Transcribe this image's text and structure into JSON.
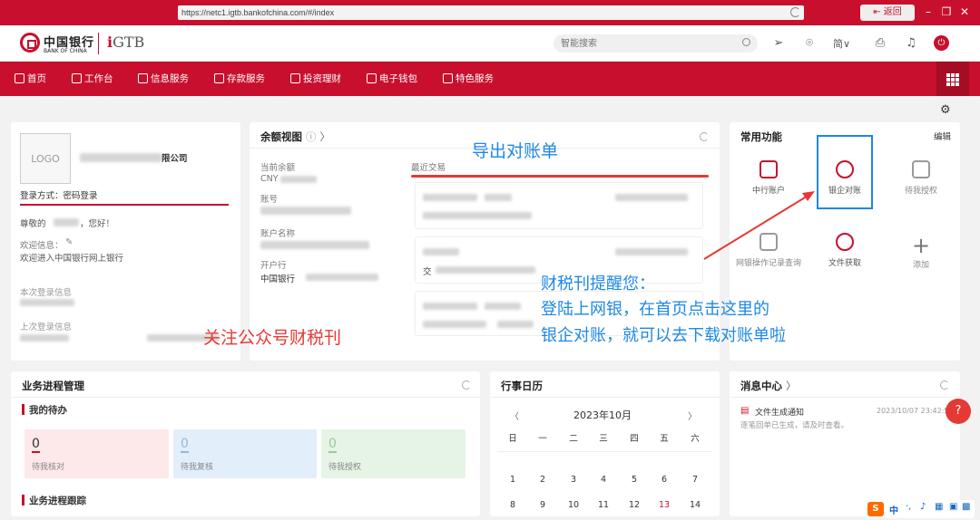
{
  "browser": {
    "url": "https://netc1.igtb.bankofchina.com/#/index",
    "back_label": "返回",
    "minimize": "–",
    "restore": "❐",
    "close": "✕"
  },
  "header": {
    "bank_name": "中国银行",
    "bank_en": "BANK OF CHINA",
    "gtb": "GTB",
    "gtb_prefix": "i",
    "search_placeholder": "智能搜索",
    "lang": "简∨"
  },
  "nav": {
    "items": [
      {
        "label": "首页"
      },
      {
        "label": "工作台"
      },
      {
        "label": "信息服务"
      },
      {
        "label": "存款服务"
      },
      {
        "label": "投资理财"
      },
      {
        "label": "电子钱包"
      },
      {
        "label": "特色服务"
      }
    ]
  },
  "profile": {
    "logo": "LOGO",
    "company_suffix": "限公司",
    "login_method": "登录方式：密码登录",
    "greeting_prefix": "尊敬的",
    "greeting_suffix": "，您好！",
    "welcome_label": "欢迎信息：",
    "welcome_text": "欢迎进入中国银行网上银行",
    "this_login": "本次登录信息",
    "last_login": "上次登录信息"
  },
  "balance": {
    "title": "余额视图",
    "current_balance": "当前余额",
    "currency": "CNY",
    "account_no": "账号",
    "account_name": "账户名称",
    "bank_branch": "开户行",
    "branch_value": "中国银行",
    "recent": "最近交易",
    "tx_prefix_1": "交",
    "tx_prefix_2": "交"
  },
  "quick": {
    "title": "常用功能",
    "edit": "编辑",
    "items": [
      {
        "label": "中行账户",
        "icon": "card-icon"
      },
      {
        "label": "银企对账",
        "icon": "yuan-icon"
      },
      {
        "label": "待我授权",
        "icon": "list-icon"
      },
      {
        "label": "网银操作记录查询",
        "icon": "monitor-icon"
      },
      {
        "label": "文件获取",
        "icon": "download-icon"
      },
      {
        "label": "添加",
        "icon": "plus-icon"
      }
    ]
  },
  "process": {
    "title": "业务进程管理",
    "my_todo": "我的待办",
    "todos": [
      {
        "count": "0",
        "label": "待我核对"
      },
      {
        "count": "0",
        "label": "待我复核"
      },
      {
        "count": "0",
        "label": "待我授权"
      }
    ],
    "tracking": "业务进程跟踪"
  },
  "calendar": {
    "title": "行事日历",
    "month": "2023年10月",
    "prev": "〈",
    "next": "〉",
    "weekdays": [
      "日",
      "一",
      "二",
      "三",
      "四",
      "五",
      "六"
    ],
    "row1": [
      "1",
      "2",
      "3",
      "4",
      "5",
      "6",
      "7"
    ],
    "row2": [
      "8",
      "9",
      "10",
      "11",
      "12",
      "13",
      "14"
    ]
  },
  "messages": {
    "title": "消息中心",
    "item_title": "文件生成通知",
    "item_time": "2023/10/07 23:42:5",
    "item_desc": "逐笔回单已生成，请及时查看。"
  },
  "annotations": {
    "export": "导出对账单",
    "follow": "关注公众号财税刊",
    "reminder_title": "财税刊提醒您：",
    "reminder_line1": "登陆上网银，在首页点击这里的",
    "reminder_line2": "银企对账，就可以去下载对账单啦"
  },
  "ime": {
    "s": "S",
    "zh": "中"
  },
  "help": "?",
  "colors": {
    "brand_red": "#c8102e",
    "annotation_blue": "#1e88e5",
    "annotation_red": "#e53935"
  }
}
